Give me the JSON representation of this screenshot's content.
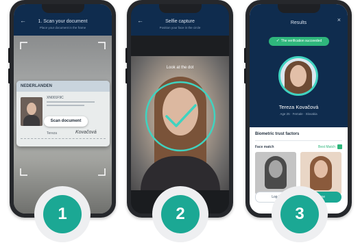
{
  "steps": [
    "1",
    "2",
    "3"
  ],
  "phone1": {
    "title": "1. Scan your document",
    "subtitle": "Place your document in the frame",
    "id_country": "NEDERLANDEN",
    "id_number": "XN001F9C",
    "id_surname": "Kovačová",
    "id_given": "Tereza",
    "scan_label": "Scan document"
  },
  "phone2": {
    "title": "Selfie capture",
    "subtitle": "Position your face in the circle",
    "hint": "Look at the dot"
  },
  "phone3": {
    "title": "Results",
    "badge": "The verification succeeded",
    "name": "Tereza Kovačová",
    "detail": "Age 25 · Female · Slovakia",
    "section": "Biometric trust factors",
    "face_match": "Face match",
    "best_match": "Best Match",
    "btn_left": "Log in",
    "btn_right": "Done",
    "check_icon": "✓"
  },
  "colors": {
    "navy": "#0f2c4e",
    "teal": "#1ba894",
    "ring": "#3fd3c0",
    "green": "#2fb67c",
    "frame": "#26282c"
  }
}
